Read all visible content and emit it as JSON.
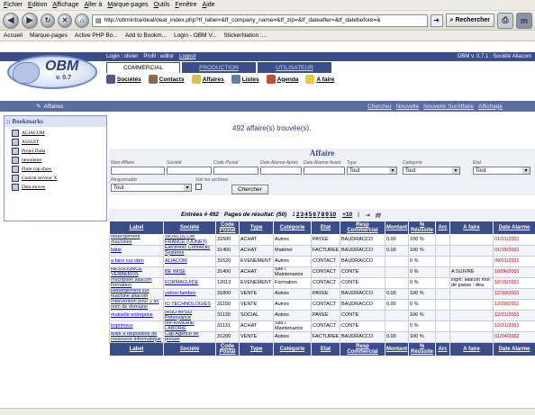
{
  "browser": {
    "menu": [
      "Fichier",
      "Edition",
      "Affichage",
      "Aller à",
      "Marque-pages",
      "Outils",
      "Fenêtre",
      "Aide"
    ],
    "url": "http://obmintra/deal/deal_index.php?tf_label=&tf_company_name=&tf_zip=&tf_dateafter=&tf_datebefore=&",
    "search_label": "Rechercher",
    "bookmarks": [
      "Accueil",
      "Marque-pages",
      "Active PHP Bo...",
      "Add to Bookm...",
      "Login - OBM V...",
      "StickerNation :..."
    ]
  },
  "obm": {
    "user_line": {
      "login": "Login : olivier",
      "profile": "Profil : editor",
      "logout": "Logout"
    },
    "version_line": "OBM v. 0.7.1 : Société Aliacom",
    "logo_text": "OBM",
    "logo_version": "v. 0.7",
    "tabs": [
      "COMMERCIAL",
      "PRODUCTION",
      "UTILISATEUR"
    ],
    "modules": [
      "Sociétés",
      "Contacts",
      "Affaires",
      "Listes",
      "Agenda",
      "A faire"
    ],
    "section": "Affaires",
    "section_links": [
      "Chercher",
      "Nouvelle",
      "Nouvelle SurAffaire",
      "Affichage"
    ]
  },
  "bookmarks_panel": {
    "title": ":: Bookmarks",
    "items": [
      "ALIACOM",
      "ASSUIT",
      "Projet Dada",
      "newsletter",
      "Flute cop show",
      "Contrat serveur X",
      "Data moves"
    ]
  },
  "found_text": "492 affaire(s) trouvée(s).",
  "search": {
    "title": "Affaire",
    "labels": {
      "name": "Nom Affaire",
      "company": "Société",
      "zip": "Code Postal",
      "date_after": "Date Alarme Après",
      "date_before": "Date Alarme Avant",
      "type": "Type",
      "category": "Catégorie",
      "state": "Etat",
      "responsible": "Responsable",
      "archives": "Voir les archives"
    },
    "type_value": "Tout",
    "category_value": "Tout",
    "state_value": "Tout",
    "responsible_value": "Tout",
    "button": "Chercher"
  },
  "pager": {
    "entries": "Entrées # 492",
    "pages": "Pages de résultat: (50)",
    "page_numbers": [
      "1",
      "2",
      "3",
      "4",
      "5",
      "6",
      "7",
      "8",
      "9",
      "10"
    ],
    "more": "+10",
    "pipe": "|"
  },
  "table": {
    "headers": [
      "Label",
      "Société",
      "Code Postal",
      "Type",
      "Catégorie",
      "Etat",
      "Resp Commercial",
      "Montant",
      "% Réussite",
      "Arc",
      "A faire",
      "Date Alarme"
    ],
    "rows": [
      [
        "hebergement machines",
        "WORLDCOM FRANCE (UUNET)",
        "31500",
        "ACHAT",
        "Autres",
        "PAYEE",
        "BAUDRACCO",
        "0.00",
        "100 %",
        "",
        "",
        "01/01/2001"
      ],
      [
        "bâtie",
        "Electronic Connectic Système",
        "31400",
        "ACHAT",
        "Matériel",
        "FACTUREE",
        "BAUDRACCO",
        "0.00",
        "100 %",
        "",
        "",
        "01/15/2001"
      ],
      [
        "a faire sur obm",
        "ALIACOM",
        "31520",
        "EVENEMENT",
        "Autres",
        "CONTACT",
        "BAUDRACCO",
        "",
        "0 %",
        "",
        "",
        "09/01/2001"
      ],
      [
        "RESSOURCE VERBEROS",
        "BE WISE",
        "31400",
        "ACHAT",
        "Sav / Maintenance",
        "CONTACT",
        "CONTE",
        "",
        "0 %",
        "",
        "A SUIVRE",
        "10/06/2001"
      ],
      [
        "Inscription aliacom formation",
        "FORMAGUIDE",
        "13013",
        "EVENEMENT",
        "Formation",
        "CONTACT",
        "CONTE",
        "",
        "0 %",
        "",
        "login: aliacon mot de passe : dea",
        "10/15/2001"
      ],
      [
        "Hebergement sur machine aliacom",
        "yahoo fambec",
        "31800",
        "VENTE",
        "Autres",
        "PAYEE",
        "BAUDRACCO",
        "0.00",
        "100 %",
        "",
        "",
        "12/10/2001"
      ],
      [
        "Intervention pour 1 an nom de domaine",
        "IO TECHNOLOGIES",
        "31150",
        "VENTE",
        "Autres",
        "CONTACT",
        "BAUDRACCO",
        "0.00",
        "0 %",
        "",
        "",
        "12/20/2001"
      ],
      [
        "mutuelle entreprise",
        "IRSO APSO Prévoyance",
        "31130",
        "SOCIAL",
        "Autres",
        "PAYEE",
        "CONTE",
        "",
        "100 %",
        "",
        "",
        "12/31/2001"
      ],
      [
        "imprimeur",
        "IMPRIMERIE LABORIE",
        "31131",
        "ACHAT",
        "Sav / Maintenance",
        "CONTACT",
        "CONTE",
        "",
        "0 %",
        "",
        "",
        "12/31/2001"
      ],
      [
        "Mise à disposition de ressource informatique",
        "Cap Agence de presse",
        "31200",
        "VENTE",
        "Autres",
        "FACTUREE",
        "BAUDRACCO",
        "0.00",
        "100 %",
        "",
        "",
        "01/04/2002"
      ]
    ]
  }
}
